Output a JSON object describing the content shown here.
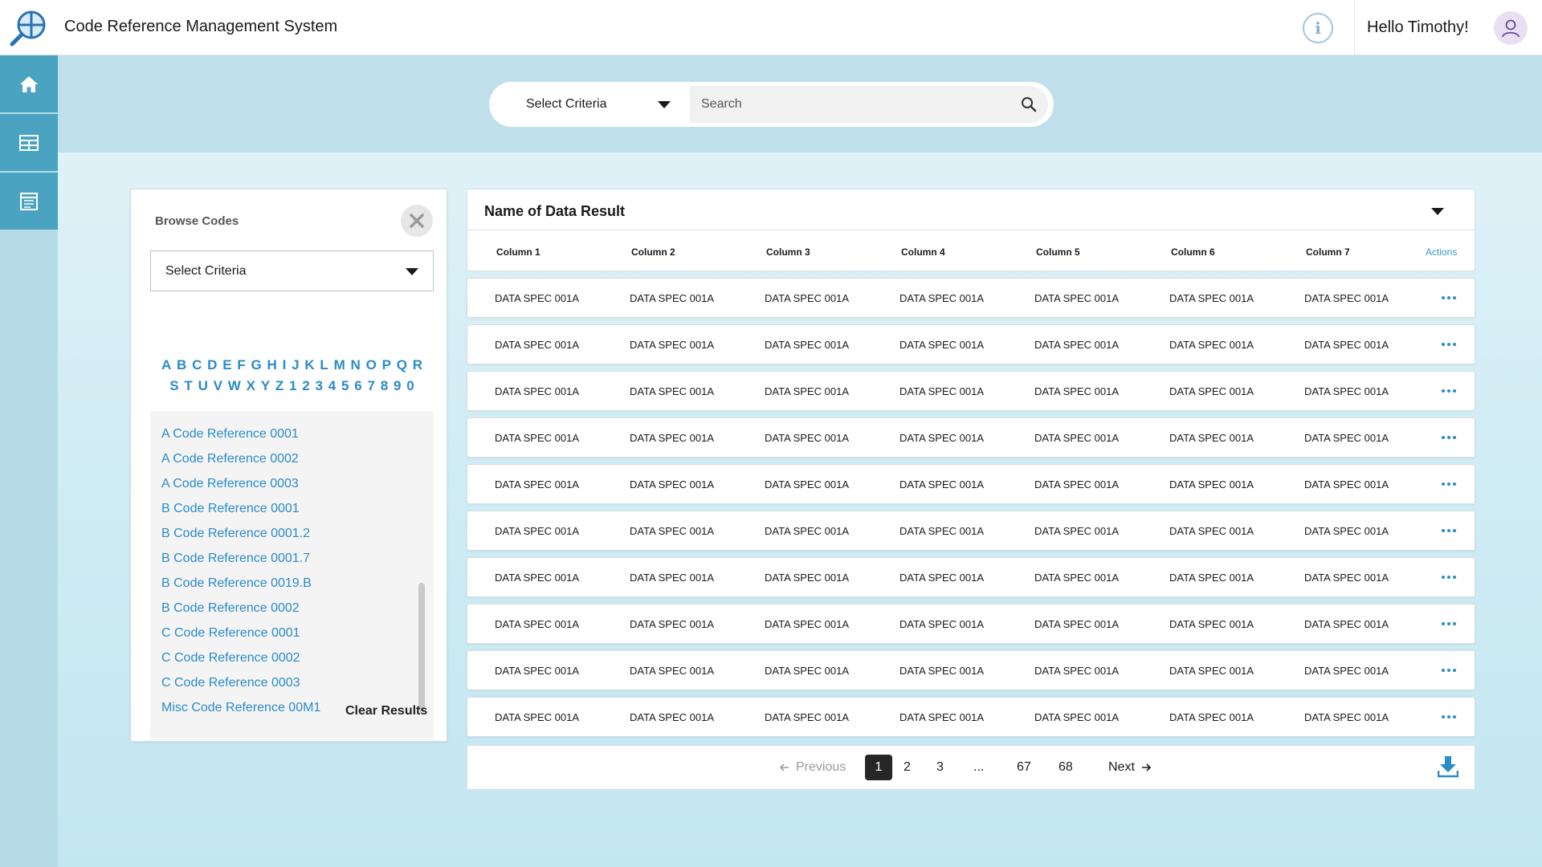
{
  "app": {
    "title": "Code Reference Management System",
    "greeting": "Hello Timothy!",
    "info_glyph": "i"
  },
  "sidebar": {
    "items": [
      {
        "icon": "home-icon"
      },
      {
        "icon": "table-icon"
      },
      {
        "icon": "form-icon"
      }
    ]
  },
  "search": {
    "criteria_label": "Select Criteria",
    "placeholder": "Search",
    "value": ""
  },
  "browse": {
    "title": "Browse Codes",
    "select_label": "Select Criteria",
    "alphabet_row1": [
      "A",
      "B",
      "C",
      "D",
      "E",
      "F",
      "G",
      "H",
      "I",
      "J",
      "K",
      "L",
      "M",
      "N",
      "O",
      "P",
      "Q",
      "R"
    ],
    "alphabet_row2": [
      "S",
      "T",
      "U",
      "V",
      "W",
      "X",
      "Y",
      "Z",
      "1",
      "2",
      "3",
      "4",
      "5",
      "6",
      "7",
      "8",
      "9",
      "0"
    ],
    "references": [
      "A Code Reference 0001",
      "A Code Reference 0002",
      "A Code Reference 0003",
      "B Code Reference 0001",
      "B Code Reference 0001.2",
      "B Code Reference 0001.7",
      "B Code Reference 0019.B",
      "B Code Reference 0002",
      "C Code Reference 0001",
      "C Code Reference 0002",
      "C Code Reference 0003",
      "Misc Code Reference 00M1"
    ],
    "clear_label": "Clear Results"
  },
  "results": {
    "title": "Name of Data Result",
    "columns": [
      "Column 1",
      "Column 2",
      "Column 3",
      "Column 4",
      "Column 5",
      "Column 6",
      "Column 7"
    ],
    "actions_label": "Actions",
    "rows": [
      [
        "DATA SPEC 001A",
        "DATA SPEC 001A",
        "DATA SPEC 001A",
        "DATA SPEC 001A",
        "DATA SPEC 001A",
        "DATA SPEC 001A",
        "DATA SPEC 001A"
      ],
      [
        "DATA SPEC 001A",
        "DATA SPEC 001A",
        "DATA SPEC 001A",
        "DATA SPEC 001A",
        "DATA SPEC 001A",
        "DATA SPEC 001A",
        "DATA SPEC 001A"
      ],
      [
        "DATA SPEC 001A",
        "DATA SPEC 001A",
        "DATA SPEC 001A",
        "DATA SPEC 001A",
        "DATA SPEC 001A",
        "DATA SPEC 001A",
        "DATA SPEC 001A"
      ],
      [
        "DATA SPEC 001A",
        "DATA SPEC 001A",
        "DATA SPEC 001A",
        "DATA SPEC 001A",
        "DATA SPEC 001A",
        "DATA SPEC 001A",
        "DATA SPEC 001A"
      ],
      [
        "DATA SPEC 001A",
        "DATA SPEC 001A",
        "DATA SPEC 001A",
        "DATA SPEC 001A",
        "DATA SPEC 001A",
        "DATA SPEC 001A",
        "DATA SPEC 001A"
      ],
      [
        "DATA SPEC 001A",
        "DATA SPEC 001A",
        "DATA SPEC 001A",
        "DATA SPEC 001A",
        "DATA SPEC 001A",
        "DATA SPEC 001A",
        "DATA SPEC 001A"
      ],
      [
        "DATA SPEC 001A",
        "DATA SPEC 001A",
        "DATA SPEC 001A",
        "DATA SPEC 001A",
        "DATA SPEC 001A",
        "DATA SPEC 001A",
        "DATA SPEC 001A"
      ],
      [
        "DATA SPEC 001A",
        "DATA SPEC 001A",
        "DATA SPEC 001A",
        "DATA SPEC 001A",
        "DATA SPEC 001A",
        "DATA SPEC 001A",
        "DATA SPEC 001A"
      ],
      [
        "DATA SPEC 001A",
        "DATA SPEC 001A",
        "DATA SPEC 001A",
        "DATA SPEC 001A",
        "DATA SPEC 001A",
        "DATA SPEC 001A",
        "DATA SPEC 001A"
      ],
      [
        "DATA SPEC 001A",
        "DATA SPEC 001A",
        "DATA SPEC 001A",
        "DATA SPEC 001A",
        "DATA SPEC 001A",
        "DATA SPEC 001A",
        "DATA SPEC 001A"
      ]
    ]
  },
  "pagination": {
    "previous_label": "Previous",
    "next_label": "Next",
    "current": "1",
    "pages": [
      "2",
      "3",
      "...",
      "67",
      "68"
    ]
  },
  "colors": {
    "accent": "#2a8bc9",
    "sidebar_active": "#4aa4c1",
    "search_band": "#bfe0ea",
    "page_bg": "#cdebf3"
  }
}
